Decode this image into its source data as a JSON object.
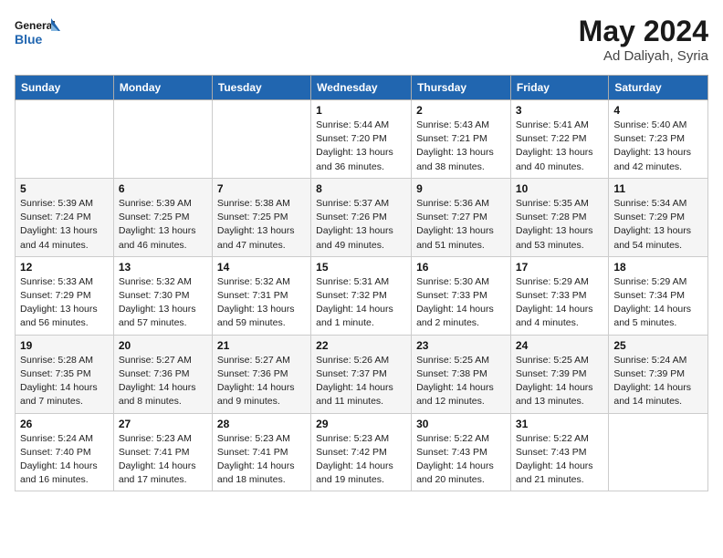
{
  "header": {
    "logo_line1": "General",
    "logo_line2": "Blue",
    "month_year": "May 2024",
    "location": "Ad Daliyah, Syria"
  },
  "days_of_week": [
    "Sunday",
    "Monday",
    "Tuesday",
    "Wednesday",
    "Thursday",
    "Friday",
    "Saturday"
  ],
  "weeks": [
    [
      {
        "day": "",
        "info": ""
      },
      {
        "day": "",
        "info": ""
      },
      {
        "day": "",
        "info": ""
      },
      {
        "day": "1",
        "info": "Sunrise: 5:44 AM\nSunset: 7:20 PM\nDaylight: 13 hours\nand 36 minutes."
      },
      {
        "day": "2",
        "info": "Sunrise: 5:43 AM\nSunset: 7:21 PM\nDaylight: 13 hours\nand 38 minutes."
      },
      {
        "day": "3",
        "info": "Sunrise: 5:41 AM\nSunset: 7:22 PM\nDaylight: 13 hours\nand 40 minutes."
      },
      {
        "day": "4",
        "info": "Sunrise: 5:40 AM\nSunset: 7:23 PM\nDaylight: 13 hours\nand 42 minutes."
      }
    ],
    [
      {
        "day": "5",
        "info": "Sunrise: 5:39 AM\nSunset: 7:24 PM\nDaylight: 13 hours\nand 44 minutes."
      },
      {
        "day": "6",
        "info": "Sunrise: 5:39 AM\nSunset: 7:25 PM\nDaylight: 13 hours\nand 46 minutes."
      },
      {
        "day": "7",
        "info": "Sunrise: 5:38 AM\nSunset: 7:25 PM\nDaylight: 13 hours\nand 47 minutes."
      },
      {
        "day": "8",
        "info": "Sunrise: 5:37 AM\nSunset: 7:26 PM\nDaylight: 13 hours\nand 49 minutes."
      },
      {
        "day": "9",
        "info": "Sunrise: 5:36 AM\nSunset: 7:27 PM\nDaylight: 13 hours\nand 51 minutes."
      },
      {
        "day": "10",
        "info": "Sunrise: 5:35 AM\nSunset: 7:28 PM\nDaylight: 13 hours\nand 53 minutes."
      },
      {
        "day": "11",
        "info": "Sunrise: 5:34 AM\nSunset: 7:29 PM\nDaylight: 13 hours\nand 54 minutes."
      }
    ],
    [
      {
        "day": "12",
        "info": "Sunrise: 5:33 AM\nSunset: 7:29 PM\nDaylight: 13 hours\nand 56 minutes."
      },
      {
        "day": "13",
        "info": "Sunrise: 5:32 AM\nSunset: 7:30 PM\nDaylight: 13 hours\nand 57 minutes."
      },
      {
        "day": "14",
        "info": "Sunrise: 5:32 AM\nSunset: 7:31 PM\nDaylight: 13 hours\nand 59 minutes."
      },
      {
        "day": "15",
        "info": "Sunrise: 5:31 AM\nSunset: 7:32 PM\nDaylight: 14 hours\nand 1 minute."
      },
      {
        "day": "16",
        "info": "Sunrise: 5:30 AM\nSunset: 7:33 PM\nDaylight: 14 hours\nand 2 minutes."
      },
      {
        "day": "17",
        "info": "Sunrise: 5:29 AM\nSunset: 7:33 PM\nDaylight: 14 hours\nand 4 minutes."
      },
      {
        "day": "18",
        "info": "Sunrise: 5:29 AM\nSunset: 7:34 PM\nDaylight: 14 hours\nand 5 minutes."
      }
    ],
    [
      {
        "day": "19",
        "info": "Sunrise: 5:28 AM\nSunset: 7:35 PM\nDaylight: 14 hours\nand 7 minutes."
      },
      {
        "day": "20",
        "info": "Sunrise: 5:27 AM\nSunset: 7:36 PM\nDaylight: 14 hours\nand 8 minutes."
      },
      {
        "day": "21",
        "info": "Sunrise: 5:27 AM\nSunset: 7:36 PM\nDaylight: 14 hours\nand 9 minutes."
      },
      {
        "day": "22",
        "info": "Sunrise: 5:26 AM\nSunset: 7:37 PM\nDaylight: 14 hours\nand 11 minutes."
      },
      {
        "day": "23",
        "info": "Sunrise: 5:25 AM\nSunset: 7:38 PM\nDaylight: 14 hours\nand 12 minutes."
      },
      {
        "day": "24",
        "info": "Sunrise: 5:25 AM\nSunset: 7:39 PM\nDaylight: 14 hours\nand 13 minutes."
      },
      {
        "day": "25",
        "info": "Sunrise: 5:24 AM\nSunset: 7:39 PM\nDaylight: 14 hours\nand 14 minutes."
      }
    ],
    [
      {
        "day": "26",
        "info": "Sunrise: 5:24 AM\nSunset: 7:40 PM\nDaylight: 14 hours\nand 16 minutes."
      },
      {
        "day": "27",
        "info": "Sunrise: 5:23 AM\nSunset: 7:41 PM\nDaylight: 14 hours\nand 17 minutes."
      },
      {
        "day": "28",
        "info": "Sunrise: 5:23 AM\nSunset: 7:41 PM\nDaylight: 14 hours\nand 18 minutes."
      },
      {
        "day": "29",
        "info": "Sunrise: 5:23 AM\nSunset: 7:42 PM\nDaylight: 14 hours\nand 19 minutes."
      },
      {
        "day": "30",
        "info": "Sunrise: 5:22 AM\nSunset: 7:43 PM\nDaylight: 14 hours\nand 20 minutes."
      },
      {
        "day": "31",
        "info": "Sunrise: 5:22 AM\nSunset: 7:43 PM\nDaylight: 14 hours\nand 21 minutes."
      },
      {
        "day": "",
        "info": ""
      }
    ]
  ]
}
